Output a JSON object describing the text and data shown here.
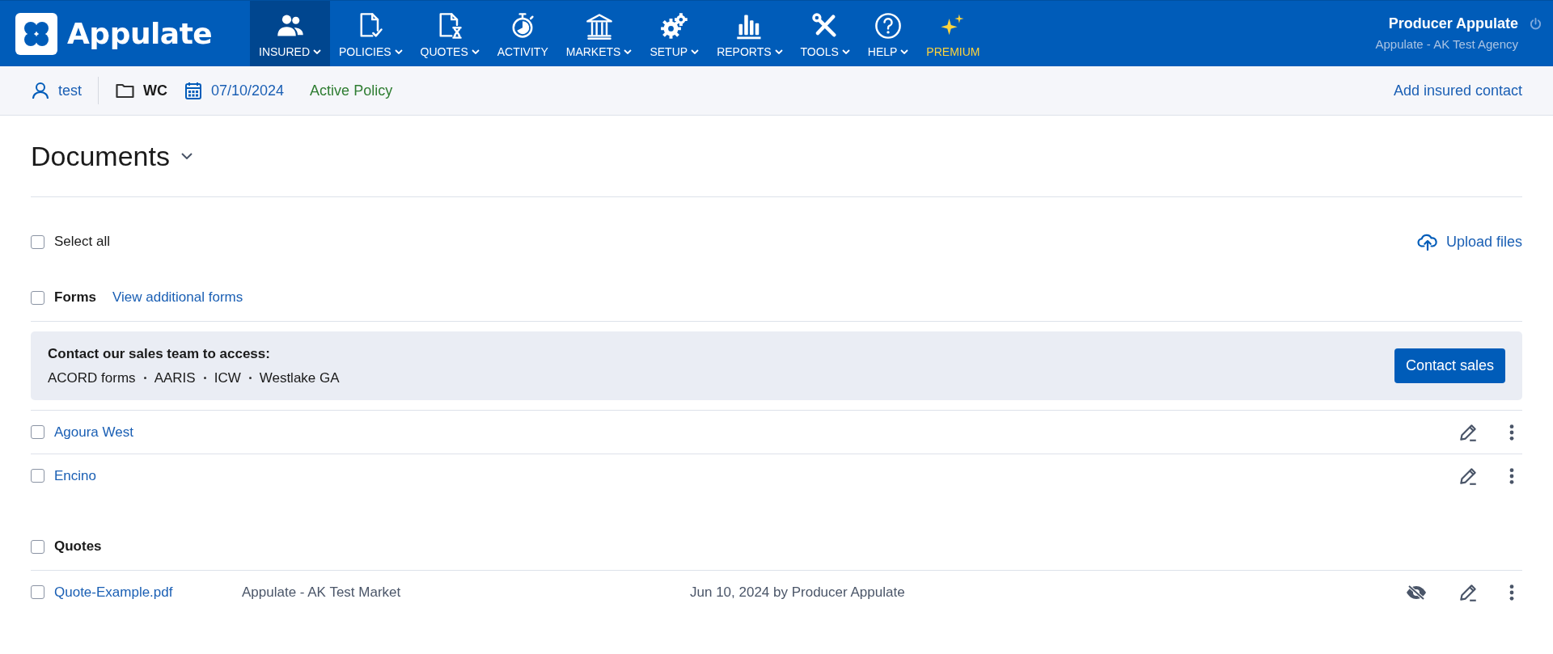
{
  "header": {
    "logo_text": "Appulate",
    "nav": [
      {
        "label": "INSURED",
        "has_menu": true,
        "selected": true,
        "kind": "normal"
      },
      {
        "label": "POLICIES",
        "has_menu": true,
        "selected": false,
        "kind": "normal"
      },
      {
        "label": "QUOTES",
        "has_menu": true,
        "selected": false,
        "kind": "normal"
      },
      {
        "label": "ACTIVITY",
        "has_menu": false,
        "selected": false,
        "kind": "normal"
      },
      {
        "label": "MARKETS",
        "has_menu": true,
        "selected": false,
        "kind": "normal"
      },
      {
        "label": "SETUP",
        "has_menu": true,
        "selected": false,
        "kind": "normal"
      },
      {
        "label": "REPORTS",
        "has_menu": true,
        "selected": false,
        "kind": "normal"
      },
      {
        "label": "TOOLS",
        "has_menu": true,
        "selected": false,
        "kind": "normal"
      },
      {
        "label": "HELP",
        "has_menu": true,
        "selected": false,
        "kind": "normal"
      },
      {
        "label": "PREMIUM",
        "has_menu": false,
        "selected": false,
        "kind": "premium"
      }
    ],
    "user": {
      "name": "Producer Appulate",
      "agency": "Appulate - AK Test Agency"
    }
  },
  "context_bar": {
    "insured": "test",
    "line": "WC",
    "date": "07/10/2024",
    "status": "Active Policy",
    "action": "Add insured contact"
  },
  "page": {
    "title": "Documents",
    "select_all": {
      "label": "Select all",
      "checked": false
    },
    "upload": "Upload files",
    "sections": [
      {
        "title": "Forms",
        "checked": false,
        "link": "View additional forms",
        "banner": {
          "heading": "Contact our sales team to access:",
          "items": [
            "ACORD forms",
            "AARIS",
            "ICW",
            "Westlake GA"
          ],
          "button": "Contact sales"
        },
        "documents": [
          {
            "name": "Agoura West",
            "checked": false,
            "hidden": false
          },
          {
            "name": "Encino",
            "checked": false,
            "hidden": false
          }
        ]
      },
      {
        "title": "Quotes",
        "checked": false,
        "documents": [
          {
            "name": "Quote-Example.pdf",
            "checked": false,
            "hidden": true,
            "market": "Appulate - AK Test Market",
            "uploaded": "Jun 10, 2024 by Producer Appulate"
          }
        ]
      }
    ]
  }
}
